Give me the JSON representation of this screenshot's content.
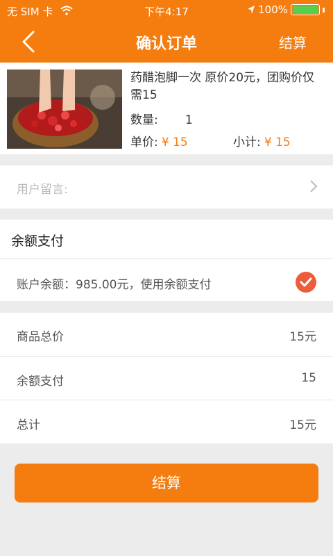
{
  "status_bar": {
    "carrier": "无 SIM 卡",
    "time": "下午4:17",
    "battery_percent": "100%",
    "battery_level": 1.0
  },
  "nav": {
    "title": "确认订单",
    "action_label": "结算",
    "back_icon": "chevron-left-icon"
  },
  "product": {
    "title": "药醋泡脚一次 原价20元，团购价仅需15",
    "qty_label": "数量:",
    "qty_value": "1",
    "unit_price_label": "单价:",
    "unit_price_value": "¥ 15",
    "subtotal_label": "小计:",
    "subtotal_value": "¥ 15"
  },
  "message": {
    "placeholder": "用户留言:"
  },
  "balance": {
    "section_title": "余额支付",
    "text": "账户余额：985.00元，使用余额支付",
    "selected": true
  },
  "summary": {
    "rows": [
      {
        "label": "商品总价",
        "value": "15元"
      },
      {
        "label": "余额支付",
        "value": "15"
      },
      {
        "label": "总计",
        "value": "15元"
      }
    ]
  },
  "submit_label": "结算",
  "colors": {
    "accent": "#f57c0f",
    "check": "#ee5d3b",
    "battery": "#54d14c"
  }
}
